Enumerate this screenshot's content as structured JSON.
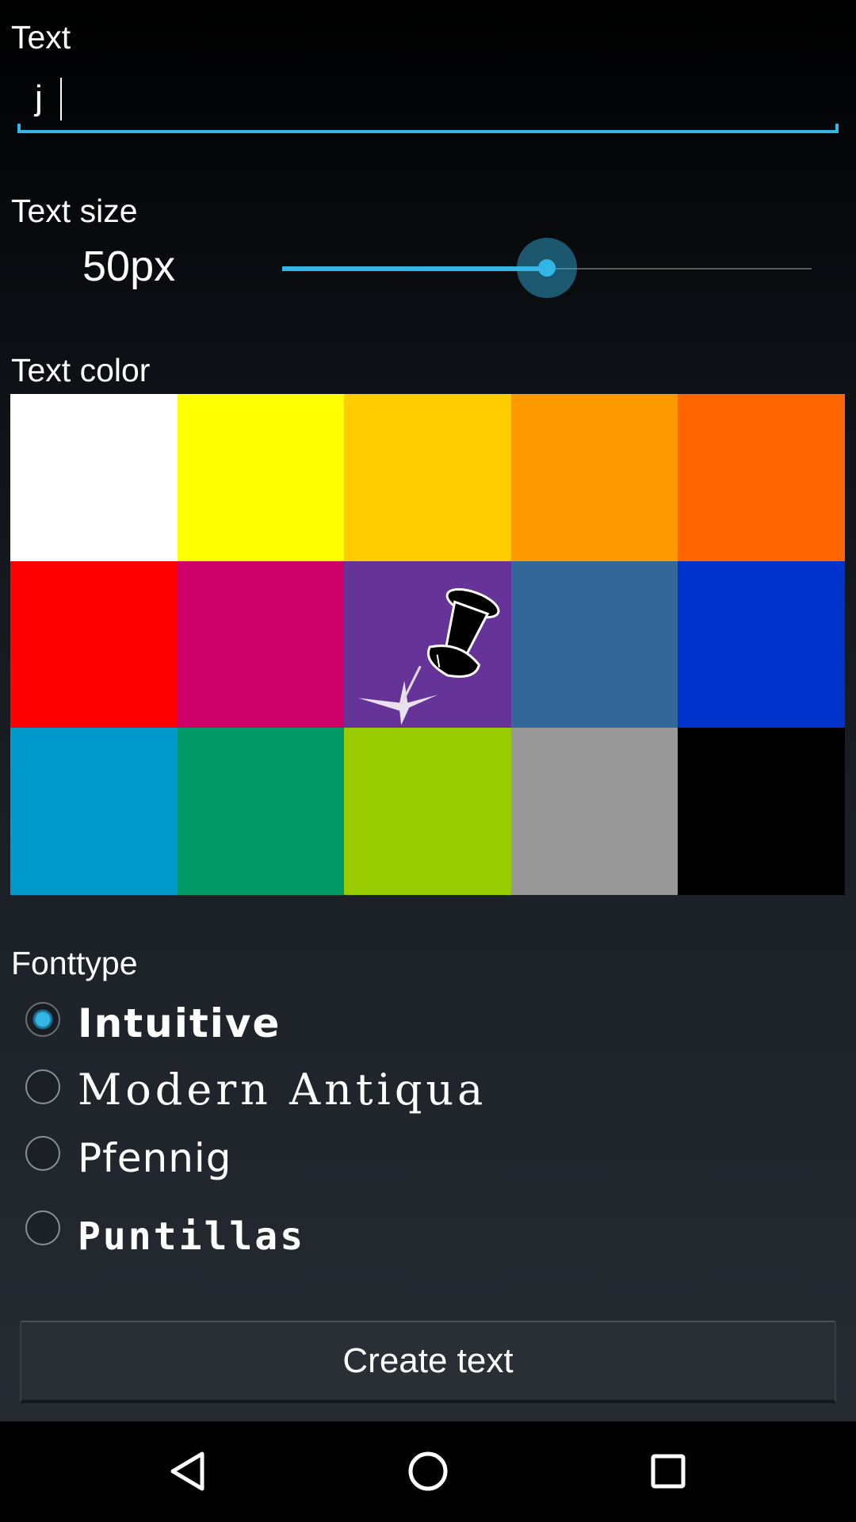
{
  "text_section": {
    "label": "Text",
    "input_value": "j"
  },
  "size_section": {
    "label": "Text size",
    "value_label": "50px",
    "slider_fraction": 0.5
  },
  "color_section": {
    "label": "Text color",
    "swatches": [
      {
        "name": "white",
        "color": "#ffffff"
      },
      {
        "name": "yellow",
        "color": "#ffff00"
      },
      {
        "name": "gold",
        "color": "#ffcc00"
      },
      {
        "name": "orange",
        "color": "#ff9900"
      },
      {
        "name": "dark-orange",
        "color": "#ff6600"
      },
      {
        "name": "red",
        "color": "#ff0000"
      },
      {
        "name": "magenta",
        "color": "#cc0066"
      },
      {
        "name": "purple-custom",
        "color": "#663399",
        "icon": "pushpin-icon"
      },
      {
        "name": "steel-blue",
        "color": "#336699"
      },
      {
        "name": "blue",
        "color": "#0033cc"
      },
      {
        "name": "sky-blue",
        "color": "#0099cc"
      },
      {
        "name": "green",
        "color": "#009966"
      },
      {
        "name": "lime",
        "color": "#99cc00"
      },
      {
        "name": "gray",
        "color": "#999999"
      },
      {
        "name": "black",
        "color": "#000000"
      }
    ]
  },
  "font_section": {
    "label": "Fonttype",
    "options": [
      {
        "label": "Intuitive",
        "checked": true
      },
      {
        "label": "Modern Antiqua",
        "checked": false
      },
      {
        "label": "Pfennig",
        "checked": false
      },
      {
        "label": "Puntillas",
        "checked": false
      }
    ]
  },
  "create_button": {
    "label": "Create text"
  },
  "nav_bar": {
    "back_icon": "back-triangle-icon",
    "home_icon": "home-circle-icon",
    "recents_icon": "recents-square-icon"
  },
  "colors": {
    "accent": "#33b5e5"
  }
}
